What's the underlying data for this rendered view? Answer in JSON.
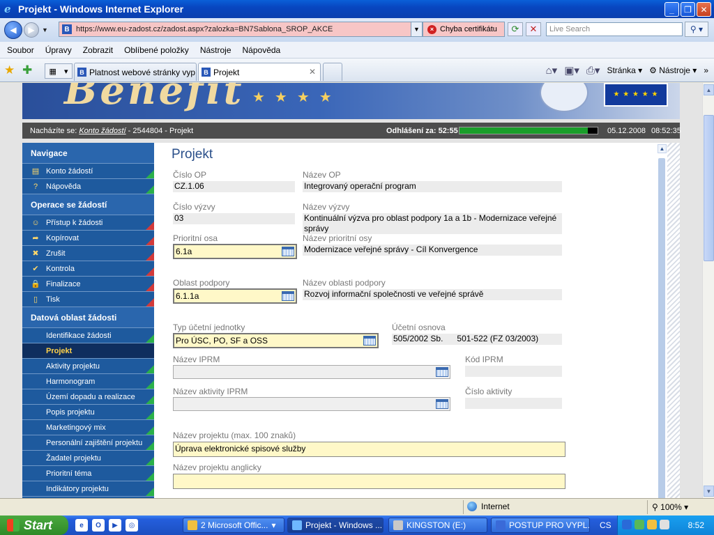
{
  "window": {
    "title": "Projekt - Windows Internet Explorer",
    "minimize": "_",
    "restore": "❐",
    "close": "✕"
  },
  "address": {
    "url": "https://www.eu-zadost.cz/zadost.aspx?zalozka=BN7Sablona_SROP_AKCE",
    "cert_error": "Chyba certifikátu",
    "search_placeholder": "Live Search"
  },
  "menu": [
    "Soubor",
    "Úpravy",
    "Zobrazit",
    "Oblíbené položky",
    "Nástroje",
    "Nápověda"
  ],
  "tabs": [
    {
      "label": "Platnost webové stránky vyp...",
      "active": false
    },
    {
      "label": "Projekt",
      "active": true
    }
  ],
  "commands": {
    "page": "Stránka",
    "tools": "Nástroje"
  },
  "strip": {
    "prefix": "Nacházíte se:",
    "link": "Konto žádostí",
    "rest": " - 2544804 - Projekt",
    "logout_label": "Odhlášení za: 52:55",
    "logout_progress": 0.93,
    "date": "05.12.2008",
    "time": "08:52:35"
  },
  "nav": {
    "sections": [
      {
        "title": "Navigace",
        "items": [
          {
            "label": "Konto žádostí",
            "icon": "book-icon"
          },
          {
            "label": "Nápověda",
            "icon": "help-icon"
          }
        ]
      },
      {
        "title": "Operace se žádostí",
        "items": [
          {
            "label": "Přístup k žádosti",
            "icon": "users-icon"
          },
          {
            "label": "Kopírovat",
            "icon": "arrow-icon"
          },
          {
            "label": "Zrušit",
            "icon": "cross-icon"
          },
          {
            "label": "Kontrola",
            "icon": "check-icon"
          },
          {
            "label": "Finalizace",
            "icon": "lock-icon"
          },
          {
            "label": "Tisk",
            "icon": "print-icon"
          }
        ]
      },
      {
        "title": "Datová oblast žádosti",
        "items": [
          {
            "label": "Identifikace žádosti"
          },
          {
            "label": "Projekt",
            "active": true
          },
          {
            "label": "Aktivity projektu"
          },
          {
            "label": "Harmonogram"
          },
          {
            "label": "Území dopadu a realizace"
          },
          {
            "label": "Popis projektu"
          },
          {
            "label": "Marketingový mix"
          },
          {
            "label": "Personální zajištění projektu"
          },
          {
            "label": "Žadatel projektu"
          },
          {
            "label": "Prioritní téma"
          },
          {
            "label": "Indikátory projektu"
          }
        ]
      }
    ]
  },
  "form": {
    "title": "Projekt",
    "cislo_op_label": "Číslo OP",
    "cislo_op": "CZ.1.06",
    "nazev_op_label": "Název OP",
    "nazev_op": "Integrovaný operační program",
    "cislo_vyzvy_label": "Číslo výzvy",
    "cislo_vyzvy": "03",
    "nazev_vyzvy_label": "Název výzvy",
    "nazev_vyzvy": "Kontinuální výzva pro oblast podpory 1a a 1b - Modernizace veřejné správy",
    "prioritni_osa_label": "Prioritní osa",
    "prioritni_osa": "6.1a",
    "nazev_prioritni_osy_label": "Název prioritní osy",
    "nazev_prioritni_osy": "Modernizace veřejné správy - Cíl Konvergence",
    "oblast_podpory_label": "Oblast podpory",
    "oblast_podpory": "6.1.1a",
    "nazev_oblasti_label": "Název oblasti podpory",
    "nazev_oblasti": "Rozvoj informační společnosti ve veřejné správě",
    "typ_uj_label": "Typ účetní jednotky",
    "typ_uj": "Pro ÚSC, PO, SF a OSS",
    "ucetni_osnova_label": "Účetní osnova",
    "ucetni_osnova": "505/2002 Sb.      501-522 (FZ 03/2003)",
    "nazev_iprm_label": "Název IPRM",
    "kod_iprm_label": "Kód IPRM",
    "nazev_aktivity_label": "Název aktivity IPRM",
    "cislo_aktivity_label": "Číslo aktivity",
    "nazev_projektu_label": "Název projektu (max. 100 znaků)",
    "nazev_projektu": "Úprava elektronické spisové služby",
    "nazev_projektu_en_label": "Název projektu anglicky",
    "nazev_projektu_en": ""
  },
  "statusbar": {
    "zone": "Internet",
    "zoom": "100%"
  },
  "taskbar": {
    "start": "Start",
    "tasks": [
      {
        "label": "2 Microsoft Offic...",
        "active": false
      },
      {
        "label": "Projekt - Windows ...",
        "active": true
      },
      {
        "label": "KINGSTON (E:)",
        "active": false
      },
      {
        "label": "POSTUP PRO VYPL...",
        "active": false
      }
    ],
    "lang": "CS",
    "clock": "8:52"
  }
}
